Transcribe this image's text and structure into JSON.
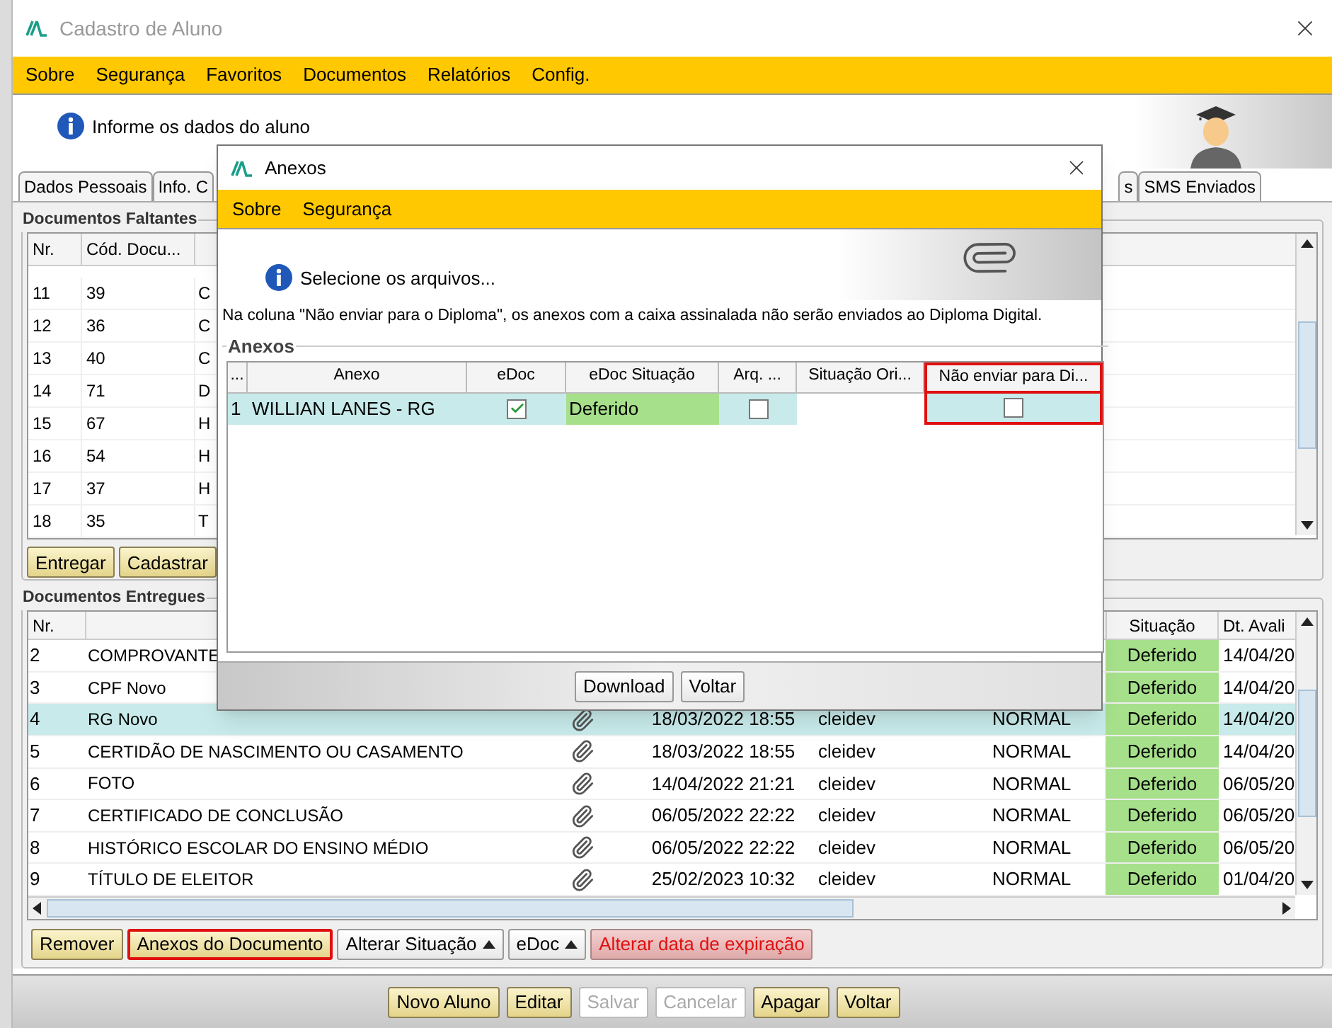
{
  "window": {
    "title": "Cadastro de Aluno",
    "menu": [
      {
        "label": "Sobre"
      },
      {
        "label": "Segurança"
      },
      {
        "label": "Favoritos"
      },
      {
        "label": "Documentos"
      },
      {
        "label": "Relatórios"
      },
      {
        "label": "Config."
      }
    ]
  },
  "header": {
    "message": "Informe os dados do aluno"
  },
  "tabs": [
    {
      "label": "Dados Pessoais",
      "selected": false
    },
    {
      "label": "Info. C",
      "selected": false
    },
    {
      "label": "s",
      "selected": false
    },
    {
      "label": "SMS Enviados",
      "selected": false
    }
  ],
  "missing_documents": {
    "title": "Documentos Faltantes",
    "columns": [
      "Nr.",
      "Cód. Docu..."
    ],
    "rows": [
      [
        "11",
        "39",
        "C"
      ],
      [
        "12",
        "36",
        "C"
      ],
      [
        "13",
        "40",
        "C"
      ],
      [
        "14",
        "71",
        "D"
      ],
      [
        "15",
        "67",
        "H"
      ],
      [
        "16",
        "54",
        "H"
      ],
      [
        "17",
        "37",
        "H"
      ],
      [
        "18",
        "35",
        "T"
      ]
    ],
    "buttons": [
      "Entregar",
      "Cadastrar"
    ]
  },
  "delivered_documents": {
    "title": "Documentos Entregues",
    "columns": [
      "Nr.",
      "Situação",
      "Dt. Avali"
    ],
    "rows": [
      {
        "nr": "2",
        "name": "COMPROVANTE",
        "status": "Deferido",
        "due": "14/04/20",
        "selected": false
      },
      {
        "nr": "3",
        "name": "CPF Novo",
        "status": "Deferido",
        "due": "14/04/20",
        "selected": false
      },
      {
        "nr": "4",
        "name": "RG Novo",
        "attachment": true,
        "date": "18/03/2022 18:55",
        "user": "cleidev",
        "type": "NORMAL",
        "status": "Deferido",
        "due": "14/04/20",
        "selected": true
      },
      {
        "nr": "5",
        "name": "CERTIDÃO DE NASCIMENTO OU CASAMENTO",
        "attachment": true,
        "date": "18/03/2022 18:55",
        "user": "cleidev",
        "type": "NORMAL",
        "status": "Deferido",
        "due": "14/04/20",
        "selected": false
      },
      {
        "nr": "6",
        "name": "FOTO",
        "attachment": true,
        "date": "14/04/2022 21:21",
        "user": "cleidev",
        "type": "NORMAL",
        "status": "Deferido",
        "due": "06/05/20",
        "selected": false
      },
      {
        "nr": "7",
        "name": "CERTIFICADO DE CONCLUSÃO",
        "attachment": true,
        "date": "06/05/2022 22:22",
        "user": "cleidev",
        "type": "NORMAL",
        "status": "Deferido",
        "due": "06/05/20",
        "selected": false
      },
      {
        "nr": "8",
        "name": "HISTÓRICO ESCOLAR DO ENSINO MÉDIO",
        "attachment": true,
        "date": "06/05/2022 22:22",
        "user": "cleidev",
        "type": "NORMAL",
        "status": "Deferido",
        "due": "06/05/20",
        "selected": false
      },
      {
        "nr": "9",
        "name": "TÍTULO DE ELEITOR",
        "attachment": true,
        "date": "25/02/2023 10:32",
        "user": "cleidev",
        "type": "NORMAL",
        "status": "Deferido",
        "due": "01/04/20",
        "selected": false
      }
    ],
    "buttons": [
      {
        "label": "Remover",
        "kind": "primary",
        "highlighted": false
      },
      {
        "label": "Anexos do Documento",
        "kind": "primary",
        "highlighted": true
      },
      {
        "label": "Alterar Situação",
        "kind": "menu",
        "highlighted": false
      },
      {
        "label": "eDoc",
        "kind": "menu",
        "highlighted": false
      },
      {
        "label": "Alterar data de expiração",
        "kind": "danger",
        "highlighted": false
      }
    ]
  },
  "footer_buttons": [
    {
      "label": "Novo Aluno",
      "disabled": false
    },
    {
      "label": "Editar",
      "disabled": false
    },
    {
      "label": "Salvar",
      "disabled": true
    },
    {
      "label": "Cancelar",
      "disabled": true
    },
    {
      "label": "Apagar",
      "disabled": false
    },
    {
      "label": "Voltar",
      "disabled": false
    }
  ],
  "dialog": {
    "title": "Anexos",
    "menu": [
      "Sobre",
      "Segurança"
    ],
    "message": "Selecione os arquivos...",
    "note": "Na coluna \"Não enviar para o Diploma\", os anexos com a caixa assinalada não serão enviados ao Diploma Digital.",
    "group": "Anexos",
    "columns": [
      {
        "label": "...",
        "highlighted": false
      },
      {
        "label": "Anexo",
        "highlighted": false
      },
      {
        "label": "eDoc",
        "highlighted": false
      },
      {
        "label": "eDoc Situação",
        "highlighted": false
      },
      {
        "label": "Arq. ...",
        "highlighted": false
      },
      {
        "label": "Situação Ori...",
        "highlighted": false
      },
      {
        "label": "Não enviar para Di...",
        "highlighted": true
      }
    ],
    "rows": [
      {
        "nr": "1",
        "anexo": "WILLIAN LANES - RG",
        "edoc": true,
        "situacao": "Deferido",
        "arq": false,
        "nao_enviar": false,
        "selected": true
      }
    ],
    "buttons": [
      "Download",
      "Voltar"
    ]
  }
}
